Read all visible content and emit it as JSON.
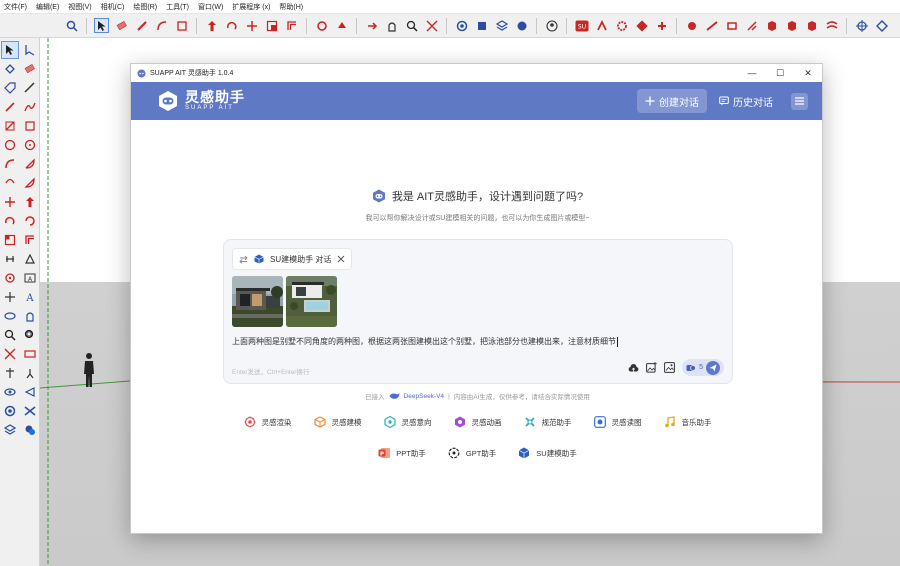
{
  "menubar": {
    "items": [
      "文件(F)",
      "编辑(E)",
      "视图(V)",
      "相机(C)",
      "绘图(R)",
      "工具(T)",
      "窗口(W)",
      "扩展程序 (x)",
      "帮助(H)"
    ]
  },
  "window": {
    "title": "SUAPP AIT 灵感助手 1.0.4",
    "controls": [
      "—",
      "☐",
      "✕"
    ]
  },
  "header": {
    "logo_name": "灵感助手",
    "logo_sub": "SUAPP AIT",
    "new_chat": "创建对话",
    "history": "历史对话"
  },
  "greeting": {
    "title": "我是 AIT灵感助手，设计遇到问题了吗?",
    "subtitle": "我可以帮你解决设计或SU建模相关的问题，也可以为你生成图片或模型~"
  },
  "chat": {
    "chip_label": "SU建模助手 对话",
    "prompt": "上面两种图是别墅不同角度的两种图，根据这两张图建模出这个别墅，把泳池部分也建模出来，注意材质细节",
    "hint": "Enter发送，Ctrl+Enter换行",
    "credit_count": "5"
  },
  "powered": {
    "prefix": "已接入",
    "model": "DeepSeek-V4",
    "note": "内容由AI生成，仅供参考，请结合实际情况使用"
  },
  "agents_row1": [
    {
      "label": "灵感渲染",
      "icon": "render-icon",
      "color": "#e2504f"
    },
    {
      "label": "灵感建模",
      "icon": "cube-icon",
      "color": "#f08a2d"
    },
    {
      "label": "灵感意向",
      "icon": "hexagon-icon",
      "color": "#2bb3c0"
    },
    {
      "label": "灵感动画",
      "icon": "animation-icon",
      "color": "#a24fd8"
    },
    {
      "label": "规范助手",
      "icon": "rule-icon",
      "color": "#2fa7c9"
    },
    {
      "label": "灵感读图",
      "icon": "image-read-icon",
      "color": "#3b6fd6"
    },
    {
      "label": "音乐助手",
      "icon": "music-icon",
      "color": "#e6a817"
    }
  ],
  "agents_row2": [
    {
      "label": "PPT助手",
      "icon": "ppt-icon",
      "color": "#d9452b"
    },
    {
      "label": "GPT助手",
      "icon": "gpt-icon",
      "color": "#222222"
    },
    {
      "label": "SU建模助手",
      "icon": "su-icon",
      "color": "#2b5fc4"
    }
  ],
  "colors": {
    "header_bg": "#6079c4",
    "accent": "#4d6bd0"
  }
}
